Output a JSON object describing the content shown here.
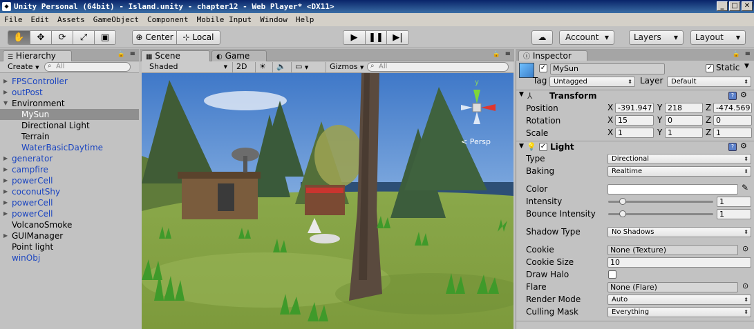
{
  "window": {
    "title": "Unity Personal (64bit) - Island.unity - chapter12 - Web Player* <DX11>",
    "min": "_",
    "max": "□",
    "close": "✕"
  },
  "menu": [
    "File",
    "Edit",
    "Assets",
    "GameObject",
    "Component",
    "Mobile Input",
    "Window",
    "Help"
  ],
  "toolbar": {
    "pivot": "Center",
    "space": "Local",
    "account": "Account",
    "layers": "Layers",
    "layout": "Layout"
  },
  "hierarchy": {
    "tab": "Hierarchy",
    "create": "Create",
    "search_placeholder": "All",
    "items": [
      {
        "label": "FPSController",
        "blue": true,
        "arrow": "▶",
        "indent": 0
      },
      {
        "label": "outPost",
        "blue": true,
        "arrow": "▶",
        "indent": 0
      },
      {
        "label": "Environment",
        "blue": false,
        "arrow": "▼",
        "indent": 0
      },
      {
        "label": "MySun",
        "blue": false,
        "arrow": "",
        "indent": 1,
        "selected": true
      },
      {
        "label": "Directional Light",
        "blue": false,
        "arrow": "",
        "indent": 1
      },
      {
        "label": "Terrain",
        "blue": false,
        "arrow": "",
        "indent": 1
      },
      {
        "label": "WaterBasicDaytime",
        "blue": true,
        "arrow": "",
        "indent": 1
      },
      {
        "label": "generator",
        "blue": true,
        "arrow": "▶",
        "indent": 0
      },
      {
        "label": "campfire",
        "blue": true,
        "arrow": "▶",
        "indent": 0
      },
      {
        "label": "powerCell",
        "blue": true,
        "arrow": "▶",
        "indent": 0
      },
      {
        "label": "coconutShy",
        "blue": true,
        "arrow": "▶",
        "indent": 0
      },
      {
        "label": "powerCell",
        "blue": true,
        "arrow": "▶",
        "indent": 0
      },
      {
        "label": "powerCell",
        "blue": true,
        "arrow": "▶",
        "indent": 0
      },
      {
        "label": "VolcanoSmoke",
        "blue": false,
        "arrow": "",
        "indent": 0
      },
      {
        "label": "GUIManager",
        "blue": false,
        "arrow": "▶",
        "indent": 0
      },
      {
        "label": "Point light",
        "blue": false,
        "arrow": "",
        "indent": 0
      },
      {
        "label": "winObj",
        "blue": true,
        "arrow": "",
        "indent": 0
      }
    ]
  },
  "scene": {
    "tab_scene": "Scene",
    "tab_game": "Game",
    "shading": "Shaded",
    "mode_2d": "2D",
    "gizmos": "Gizmos",
    "search_placeholder": "All",
    "persp": "Persp",
    "axis_y": "y"
  },
  "inspector": {
    "tab": "Inspector",
    "name": "MySun",
    "static_label": "Static",
    "tag_label": "Tag",
    "tag": "Untagged",
    "layer_label": "Layer",
    "layer": "Default",
    "transform": {
      "title": "Transform",
      "position_label": "Position",
      "rotation_label": "Rotation",
      "scale_label": "Scale",
      "position": [
        "-391.947",
        "218",
        "-474.569"
      ],
      "rotation": [
        "15",
        "0",
        "0"
      ],
      "scale": [
        "1",
        "1",
        "1"
      ]
    },
    "light": {
      "title": "Light",
      "type_label": "Type",
      "type": "Directional",
      "baking_label": "Baking",
      "baking": "Realtime",
      "color_label": "Color",
      "color": "#ffffff",
      "intensity_label": "Intensity",
      "intensity": "1",
      "intensity_fraction": 0.14,
      "bounce_label": "Bounce Intensity",
      "bounce": "1",
      "bounce_fraction": 0.14,
      "shadow_label": "Shadow Type",
      "shadow": "No Shadows",
      "cookie_label": "Cookie",
      "cookie": "None (Texture)",
      "cookie_size_label": "Cookie Size",
      "cookie_size": "10",
      "halo_label": "Draw Halo",
      "flare_label": "Flare",
      "flare": "None (Flare)",
      "render_label": "Render Mode",
      "render": "Auto",
      "culling_label": "Culling Mask",
      "culling": "Everything"
    }
  }
}
